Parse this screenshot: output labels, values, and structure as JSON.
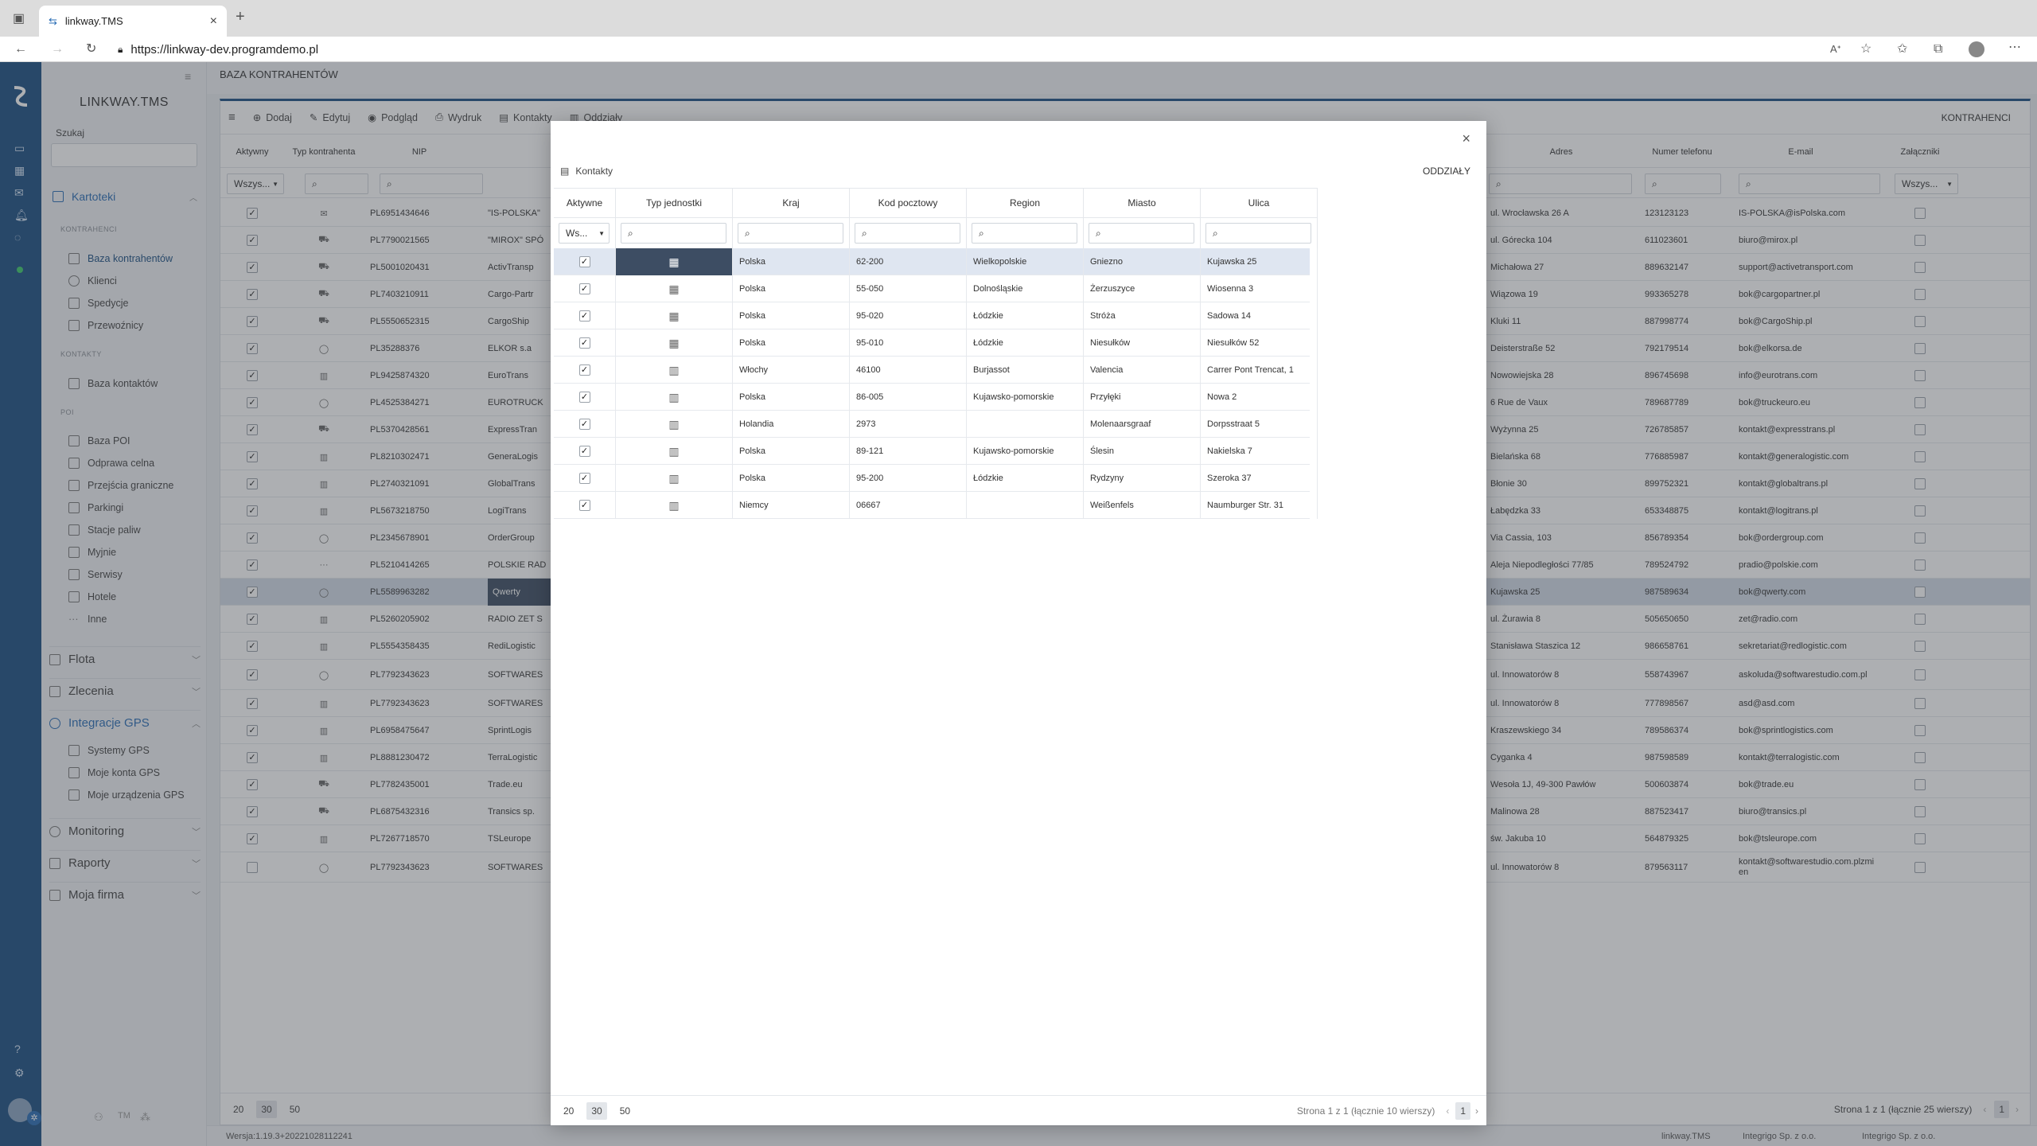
{
  "browser": {
    "tab_title": "linkway.TMS",
    "url": "https://linkway-dev.programdemo.pl"
  },
  "sidebar": {
    "logo": "LINKWAY.TMS",
    "search_label": "Szukaj",
    "kartoteki": "Kartoteki",
    "section_kontrahenci": "KONTRAHENCI",
    "kontrahenci_items": [
      "Baza kontrahentów",
      "Klienci",
      "Spedycje",
      "Przewoźnicy"
    ],
    "section_kontakty": "KONTAKTY",
    "kontakty_items": [
      "Baza kontaktów"
    ],
    "section_poi": "POI",
    "poi_items": [
      "Baza POI",
      "Odprawa celna",
      "Przejścia graniczne",
      "Parkingi",
      "Stacje paliw",
      "Myjnie",
      "Serwisy",
      "Hotele",
      "Inne"
    ],
    "flota": "Flota",
    "zlecenia": "Zlecenia",
    "integracje": "Integracje GPS",
    "gps_items": [
      "Systemy GPS",
      "Moje konta GPS",
      "Moje urządzenia GPS"
    ],
    "monitoring": "Monitoring",
    "raporty": "Raporty",
    "moja_firma": "Moja firma",
    "footer_tm": "TM"
  },
  "main": {
    "page_title": "BAZA KONTRAHENTÓW",
    "toolbar": {
      "dodaj": "Dodaj",
      "edytuj": "Edytuj",
      "podglad": "Podgląd",
      "wydruk": "Wydruk",
      "kontakty": "Kontakty",
      "oddzialy": "Oddziały"
    },
    "section_title": "KONTRAHENCI",
    "headers": {
      "aktywny": "Aktywny",
      "typ": "Typ kontrahenta",
      "nip": "NIP",
      "adres": "Adres",
      "telefon": "Numer telefonu",
      "email": "E-mail",
      "zalaczniki": "Załączniki"
    },
    "filter_all": "Wszys...",
    "rows": [
      {
        "nip": "PL6951434646",
        "name": "\"IS-POLSKA\"",
        "adres": "ul. Wrocławska 26 A",
        "tel": "123123123",
        "email": "IS-POLSKA@isPolska.com"
      },
      {
        "nip": "PL7790021565",
        "name": "\"MIROX\" SPÓ",
        "adres": "ul. Górecka 104",
        "tel": "611023601",
        "email": "biuro@mirox.pl"
      },
      {
        "nip": "PL5001020431",
        "name": "ActivTransp",
        "adres": "Michałowa 27",
        "tel": "889632147",
        "email": "support@activetransport.com"
      },
      {
        "nip": "PL7403210911",
        "name": "Cargo-Partr",
        "adres": "Wiązowa 19",
        "tel": "993365278",
        "email": "bok@cargopartner.pl"
      },
      {
        "nip": "PL5550652315",
        "name": "CargoShip",
        "adres": "Kluki 11",
        "tel": "887998774",
        "email": "bok@CargoShip.pl"
      },
      {
        "nip": "PL35288376",
        "name": "ELKOR s.a",
        "adres": "Deisterstraße 52",
        "tel": "792179514",
        "email": "bok@elkorsa.de"
      },
      {
        "nip": "PL9425874320",
        "name": "EuroTrans",
        "adres": "Nowowiejska 28",
        "tel": "896745698",
        "email": "info@eurotrans.com"
      },
      {
        "nip": "PL4525384271",
        "name": "EUROTRUCK",
        "adres": "6 Rue de Vaux",
        "tel": "789687789",
        "email": "bok@truckeuro.eu"
      },
      {
        "nip": "PL5370428561",
        "name": "ExpressTran",
        "adres": "Wyżynna 25",
        "tel": "726785857",
        "email": "kontakt@expresstrans.pl"
      },
      {
        "nip": "PL8210302471",
        "name": "GeneraLogis",
        "adres": "Bielańska 68",
        "tel": "776885987",
        "email": "kontakt@generalogistic.com"
      },
      {
        "nip": "PL2740321091",
        "name": "GlobalTrans",
        "adres": "Błonie 30",
        "tel": "899752321",
        "email": "kontakt@globaltrans.pl"
      },
      {
        "nip": "PL5673218750",
        "name": "LogiTrans",
        "adres": "Łabędzka 33",
        "tel": "653348875",
        "email": "kontakt@logitrans.pl"
      },
      {
        "nip": "PL2345678901",
        "name": "OrderGroup",
        "adres": "Via Cassia, 103",
        "tel": "856789354",
        "email": "bok@ordergroup.com"
      },
      {
        "nip": "PL5210414265",
        "name": "POLSKIE RAD",
        "adres": "Aleja Niepodległości 77/85",
        "tel": "789524792",
        "email": "pradio@polskie.com"
      },
      {
        "nip": "PL5589963282",
        "name": "Qwerty",
        "adres": "Kujawska 25",
        "tel": "987589634",
        "email": "bok@qwerty.com"
      },
      {
        "nip": "PL5260205902",
        "name": "RADIO ZET S",
        "adres": "ul. Żurawia 8",
        "tel": "505650650",
        "email": "zet@radio.com"
      },
      {
        "nip": "PL5554358435",
        "name": "RediLogistic",
        "adres": "Stanisława Staszica 12",
        "tel": "986658761",
        "email": "sekretariat@redlogistic.com"
      },
      {
        "nip": "PL7792343623",
        "name": "SOFTWARES",
        "adres": "ul. Innowatorów 8",
        "tel": "558743967",
        "email": "askoluda@softwarestudio.com.pl"
      },
      {
        "nip": "PL7792343623",
        "name": "SOFTWARES",
        "adres": "ul. Innowatorów 8",
        "tel": "777898567",
        "email": "asd@asd.com"
      },
      {
        "nip": "PL6958475647",
        "name": "SprintLogis",
        "adres": "Kraszewskiego 34",
        "tel": "789586374",
        "email": "bok@sprintlogistics.com"
      },
      {
        "nip": "PL8881230472",
        "name": "TerraLogistic",
        "adres": "Cyganka 4",
        "tel": "987598589",
        "email": "kontakt@terralogistic.com"
      },
      {
        "nip": "PL7782435001",
        "name": "Trade.eu",
        "adres": "Wesoła 1J, 49-300 Pawłów",
        "tel": "500603874",
        "email": "bok@trade.eu"
      },
      {
        "nip": "PL6875432316",
        "name": "Transics sp.",
        "adres": "Malinowa 28",
        "tel": "887523417",
        "email": "biuro@transics.pl"
      },
      {
        "nip": "PL7267718570",
        "name": "TSLeurope",
        "adres": "św. Jakuba 10",
        "tel": "564879325",
        "email": "bok@tsleurope.com"
      },
      {
        "nip": "PL7792343623",
        "name": "SOFTWARES",
        "adres": "ul. Innowatorów 8",
        "tel": "879563117",
        "email": "kontakt@softwarestudio.com.plzmien"
      }
    ],
    "pager_sizes": [
      "20",
      "30",
      "50"
    ],
    "pager_info": "Strona 1 z 1 (łącznie 25 wierszy)",
    "page_number": "1"
  },
  "statusbar": {
    "version": "Wersja:1.19.3+20221028112241",
    "app": "linkway.TMS",
    "tm_company": "Integrigo Sp. z o.o.",
    "company": "Integrigo Sp. z o.o."
  },
  "modal": {
    "close": "×",
    "kontakty_label": "Kontakty",
    "oddzialy_label": "ODDZIAŁY",
    "headers": {
      "aktywne": "Aktywne",
      "typ": "Typ jednostki",
      "kraj": "Kraj",
      "kod": "Kod pocztowy",
      "region": "Region",
      "miasto": "Miasto",
      "ulica": "Ulica"
    },
    "filter_active": "Ws...",
    "rows": [
      {
        "kraj": "Polska",
        "kod": "62-200",
        "region": "Wielkopolskie",
        "miasto": "Gniezno",
        "ulica": "Kujawska 25",
        "icon": "building-icon"
      },
      {
        "kraj": "Polska",
        "kod": "55-050",
        "region": "Dolnośląskie",
        "miasto": "Żerzuszyce",
        "ulica": "Wiosenna 3",
        "icon": "building-icon"
      },
      {
        "kraj": "Polska",
        "kod": "95-020",
        "region": "Łódzkie",
        "miasto": "Stróża",
        "ulica": "Sadowa 14",
        "icon": "building-icon"
      },
      {
        "kraj": "Polska",
        "kod": "95-010",
        "region": "Łódzkie",
        "miasto": "Niesułków",
        "ulica": "Niesułków 52",
        "icon": "building-icon"
      },
      {
        "kraj": "Włochy",
        "kod": "46100",
        "region": "Burjassot",
        "miasto": "Valencia",
        "ulica": "Carrer Pont Trencat, 1",
        "icon": "warehouse-icon"
      },
      {
        "kraj": "Polska",
        "kod": "86-005",
        "region": "Kujawsko-pomorskie",
        "miasto": "Przyłęki",
        "ulica": "Nowa 2",
        "icon": "warehouse-icon"
      },
      {
        "kraj": "Holandia",
        "kod": "2973",
        "region": "",
        "miasto": "Molenaarsgraaf",
        "ulica": "Dorpsstraat 5",
        "icon": "warehouse-icon"
      },
      {
        "kraj": "Polska",
        "kod": "89-121",
        "region": "Kujawsko-pomorskie",
        "miasto": "Ślesin",
        "ulica": "Nakielska 7",
        "icon": "warehouse-icon"
      },
      {
        "kraj": "Polska",
        "kod": "95-200",
        "region": "Łódzkie",
        "miasto": "Rydzyny",
        "ulica": "Szeroka 37",
        "icon": "warehouse-icon"
      },
      {
        "kraj": "Niemcy",
        "kod": "06667",
        "region": "",
        "miasto": "Weißenfels",
        "ulica": "Naumburger Str. 31",
        "icon": "warehouse-icon"
      }
    ],
    "pager_sizes": [
      "20",
      "30",
      "50"
    ],
    "pager_info": "Strona 1 z 1 (łącznie 10 wierszy)",
    "page_number": "1"
  }
}
